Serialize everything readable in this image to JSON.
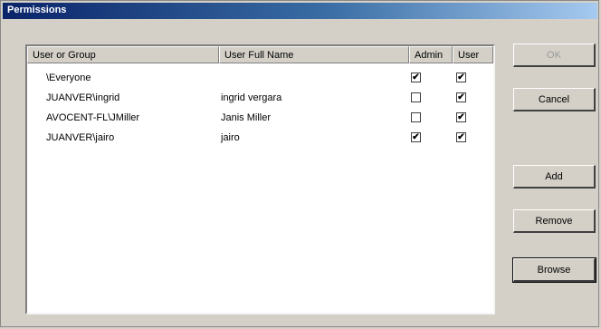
{
  "window": {
    "title": "Permissions"
  },
  "table": {
    "columns": [
      "User or Group",
      "User Full Name",
      "Admin",
      "User"
    ],
    "rows": [
      {
        "user": "\\Everyone",
        "full_name": "",
        "admin": true,
        "user_perm": true
      },
      {
        "user": "JUANVER\\ingrid",
        "full_name": "ingrid vergara",
        "admin": false,
        "user_perm": true
      },
      {
        "user": "AVOCENT-FL\\JMiller",
        "full_name": "Janis Miller",
        "admin": false,
        "user_perm": true
      },
      {
        "user": "JUANVER\\jairo",
        "full_name": "jairo",
        "admin": true,
        "user_perm": true
      }
    ]
  },
  "buttons": {
    "ok": "OK",
    "cancel": "Cancel",
    "add": "Add",
    "remove": "Remove",
    "browse": "Browse"
  },
  "check_glyph": "✔"
}
